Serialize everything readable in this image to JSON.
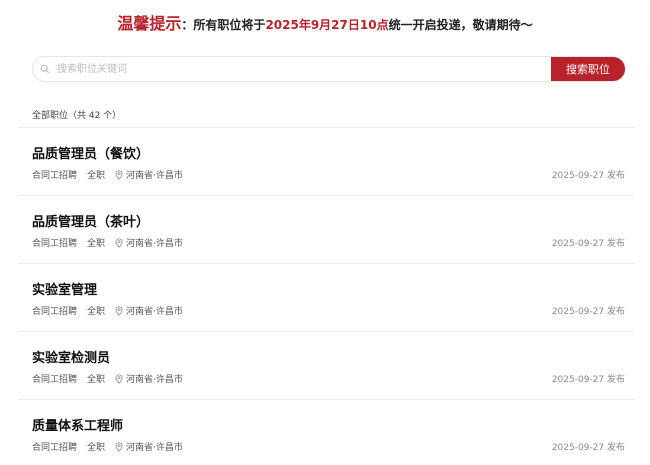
{
  "notice": {
    "label": "温馨提示",
    "colon": "：",
    "text_before": "所有职位将于",
    "date": "2025年9月27日10点",
    "text_after": "统一开启投递，敬请期待～"
  },
  "search": {
    "placeholder": "搜索职位关键词",
    "button_label": "搜索职位",
    "icon": "search-icon"
  },
  "summary": "全部职位（共 42 个）",
  "colors": {
    "accent": "#b8232b"
  },
  "jobs": [
    {
      "title": "品质管理员（餐饮）",
      "type": "合同工招聘",
      "nature": "全职",
      "location": "河南省·许昌市",
      "published": "2025-09-27 发布"
    },
    {
      "title": "品质管理员（茶叶）",
      "type": "合同工招聘",
      "nature": "全职",
      "location": "河南省·许昌市",
      "published": "2025-09-27 发布"
    },
    {
      "title": "实验室管理",
      "type": "合同工招聘",
      "nature": "全职",
      "location": "河南省·许昌市",
      "published": "2025-09-27 发布"
    },
    {
      "title": "实验室检测员",
      "type": "合同工招聘",
      "nature": "全职",
      "location": "河南省·许昌市",
      "published": "2025-09-27 发布"
    },
    {
      "title": "质量体系工程师",
      "type": "合同工招聘",
      "nature": "全职",
      "location": "河南省·许昌市",
      "published": "2025-09-27 发布"
    }
  ]
}
